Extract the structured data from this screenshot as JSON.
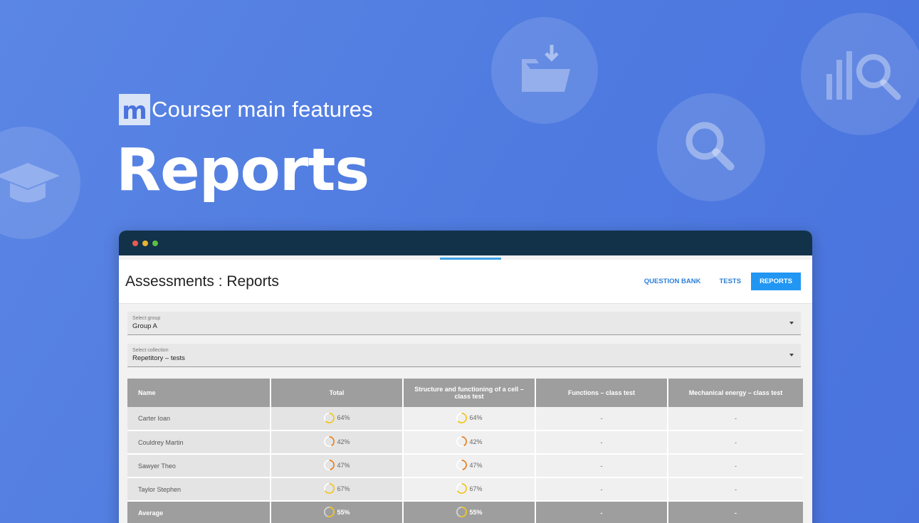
{
  "brand": {
    "logo_letter": "m",
    "tagline": "Courser main features"
  },
  "hero": {
    "title": "Reports"
  },
  "background_icons": [
    "graduation-cap-icon",
    "download-folder-icon",
    "search-icon",
    "analytics-search-icon"
  ],
  "window": {
    "traffic_lights": [
      "#e95b4f",
      "#e7b42b",
      "#5cbf3f"
    ],
    "app_title": "Assessments : Reports",
    "tabs": [
      {
        "label": "QUESTION BANK",
        "active": false
      },
      {
        "label": "TESTS",
        "active": false
      },
      {
        "label": "REPORTS",
        "active": true
      }
    ],
    "group_select": {
      "label": "Select group",
      "value": "Group A"
    },
    "collection_select": {
      "label": "Select collection",
      "value": "Repetitory – tests"
    }
  },
  "table": {
    "headers": [
      "Name",
      "Total",
      "Structure and functioning of a cell – class test",
      "Functions – class test",
      "Mechanical energy – class test"
    ],
    "rows": [
      {
        "name": "Carter Ioan",
        "total": "64%",
        "total_pct": 64,
        "structure": "64%",
        "structure_pct": 64,
        "functions": "-",
        "energy": "-",
        "color": "#f2c318"
      },
      {
        "name": "Couldrey Martin",
        "total": "42%",
        "total_pct": 42,
        "structure": "42%",
        "structure_pct": 42,
        "functions": "-",
        "energy": "-",
        "color": "#e67e22"
      },
      {
        "name": "Sawyer Theo",
        "total": "47%",
        "total_pct": 47,
        "structure": "47%",
        "structure_pct": 47,
        "functions": "-",
        "energy": "-",
        "color": "#e67e22"
      },
      {
        "name": "Taylor Stephen",
        "total": "67%",
        "total_pct": 67,
        "structure": "67%",
        "structure_pct": 67,
        "functions": "-",
        "energy": "-",
        "color": "#f2c318"
      }
    ],
    "average": {
      "name": "Average",
      "total": "55%",
      "total_pct": 55,
      "structure": "55%",
      "structure_pct": 55,
      "functions": "-",
      "energy": "-",
      "color": "#f2c318"
    }
  }
}
